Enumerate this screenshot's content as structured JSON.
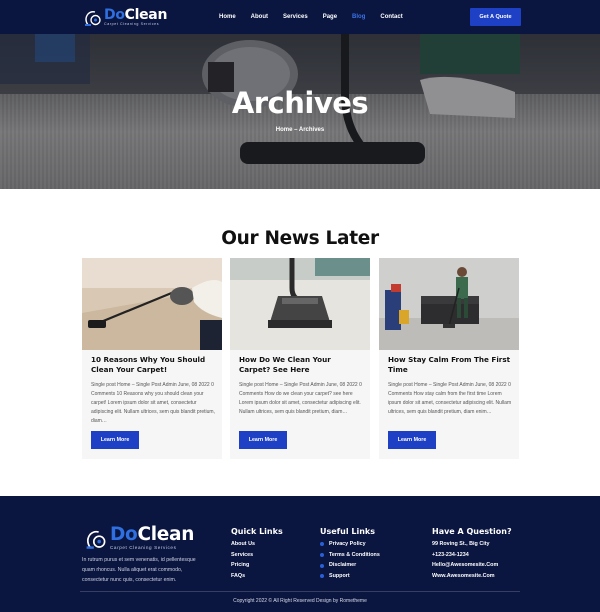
{
  "header": {
    "logo": {
      "word_do": "Do",
      "word_clean": "Clean",
      "tagline": "Carpet Cleaning Services"
    },
    "nav": [
      "Home",
      "About",
      "Services",
      "Page",
      "Blog",
      "Contact"
    ],
    "active_nav": "Blog",
    "cta": "Get A Quote"
  },
  "hero": {
    "title": "Archives",
    "breadcrumb": "Home – Archives"
  },
  "news": {
    "title": "Our News Later",
    "read_more": "Learn More",
    "posts": [
      {
        "title": "10 Reasons Why You Should Clean Your Carpet!",
        "excerpt": "Single post Home – Single Post Admin June, 08 2022 0 Comments 10 Reasons why you should clean your carpet! Lorem ipsum dolor sit amet, consectetur adipiscing elit. Nullam ultrices, sem quis blandit pretium, diam…"
      },
      {
        "title": "How Do We Clean Your Carpet? See Here",
        "excerpt": "Single post Home – Single Post Admin June, 08 2022 0 Comments How do we clean your carpet? see here Lorem ipsum dolor sit amet, consectetur adipiscing elit. Nullam ultrices, sem quis blandit pretium, diam…"
      },
      {
        "title": "How Stay Calm From The First Time",
        "excerpt": "Single post Home – Single Post Admin June, 08 2022 0 Comments How stay calm from the first time Lorem ipsum dolor sit amet, consectetur adipiscing elit. Nullam ultrices, sem quis blandit pretium, diam enim…"
      }
    ]
  },
  "footer": {
    "logo": {
      "word_do": "Do",
      "word_clean": "Clean",
      "tagline": "Carpet Cleaning Services"
    },
    "about": "In rutrum purus et sem venenatis, id pellentesque quam rhoncus. Nulla aliquet erat commodo, consectetur nunc quis, consectetur enim.",
    "quick_links": {
      "title": "Quick Links",
      "items": [
        "About Us",
        "Services",
        "Pricing",
        "FAQs"
      ]
    },
    "useful_links": {
      "title": "Useful Links",
      "items": [
        "Privacy Policy",
        "Terms & Conditions",
        "Disclaimer",
        "Support"
      ]
    },
    "contact": {
      "title": "Have A Question?",
      "items": [
        "99 Roving St., Big City",
        "+123-234-1234",
        "Hello@Awesomesite.Com",
        "Www.Awesomesite.Com"
      ]
    },
    "copyright": "Copyright 2022 © All Right Reserved Design by Rometheme"
  },
  "colors": {
    "navy": "#0a1540",
    "accent": "#1e40c4",
    "active_nav": "#3b74e6"
  },
  "icons": [
    "vacuum-logo-icon",
    "bullet-dot-icon"
  ]
}
